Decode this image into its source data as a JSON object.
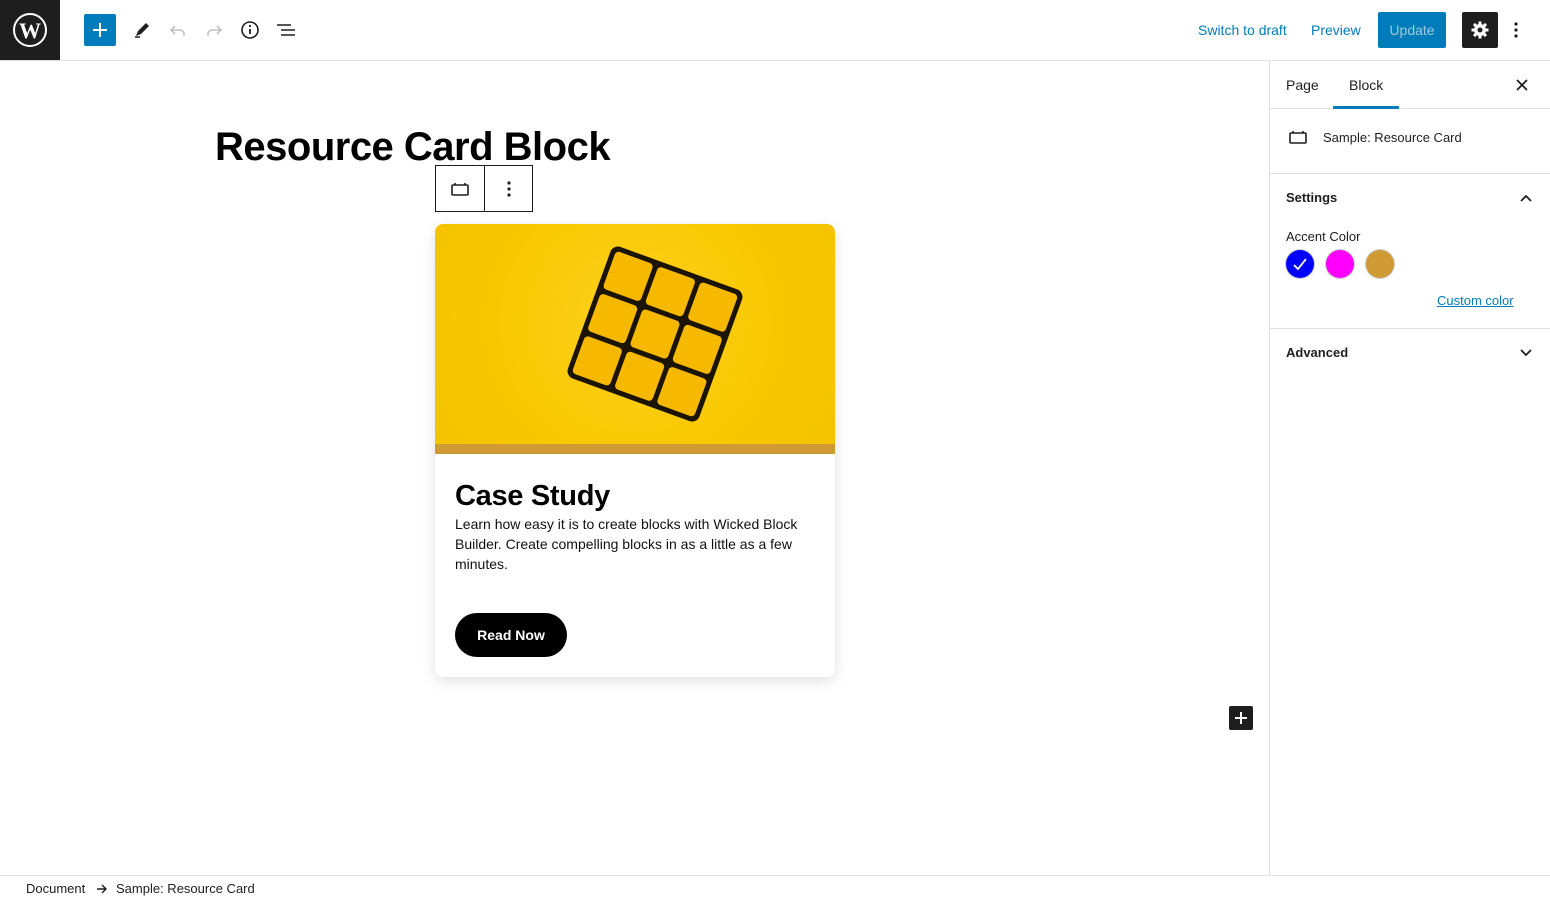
{
  "topbar": {
    "logo_icon": "wordpress-logo-icon",
    "tools": [
      "add-block-icon",
      "edit-tools-icon",
      "undo-icon",
      "redo-icon",
      "info-icon",
      "list-view-icon"
    ],
    "switch_to_draft": "Switch to draft",
    "preview": "Preview",
    "update": "Update",
    "settings_icon": "gear-icon",
    "more_icon": "vertical-ellipsis-icon",
    "colors": {
      "accent": "#007cba",
      "dark": "#1e1e1e"
    }
  },
  "editor": {
    "title": "Resource Card Block",
    "block_toolbar": {
      "block_icon": "card-block-icon",
      "options_icon": "vertical-ellipsis-icon"
    },
    "card": {
      "image_description_icon": "rubiks-cube-icon",
      "accent_color": "#cf9a34",
      "heading": "Case Study",
      "body": "Learn how easy it is to create blocks with Wicked Block Builder. Create compelling blocks in as a little as a few minutes.",
      "button": "Read Now"
    },
    "append_icon": "plus-icon"
  },
  "sidebar": {
    "tabs": [
      {
        "label": "Page",
        "active": false
      },
      {
        "label": "Block",
        "active": true
      }
    ],
    "close_icon": "close-icon",
    "block_name": "Sample: Resource Card",
    "settings_panel": {
      "title": "Settings",
      "expanded": true,
      "accent_label": "Accent Color",
      "swatches": [
        {
          "name": "blue",
          "color": "#0000ff",
          "selected": true
        },
        {
          "name": "magenta",
          "color": "#ff00ff",
          "selected": false
        },
        {
          "name": "gold",
          "color": "#cf9a34",
          "selected": false
        }
      ],
      "custom_color": "Custom color"
    },
    "advanced_panel": {
      "title": "Advanced",
      "expanded": false
    }
  },
  "breadcrumb": {
    "items": [
      "Document",
      "Sample: Resource Card"
    ],
    "separator_icon": "arrow-right-icon"
  }
}
